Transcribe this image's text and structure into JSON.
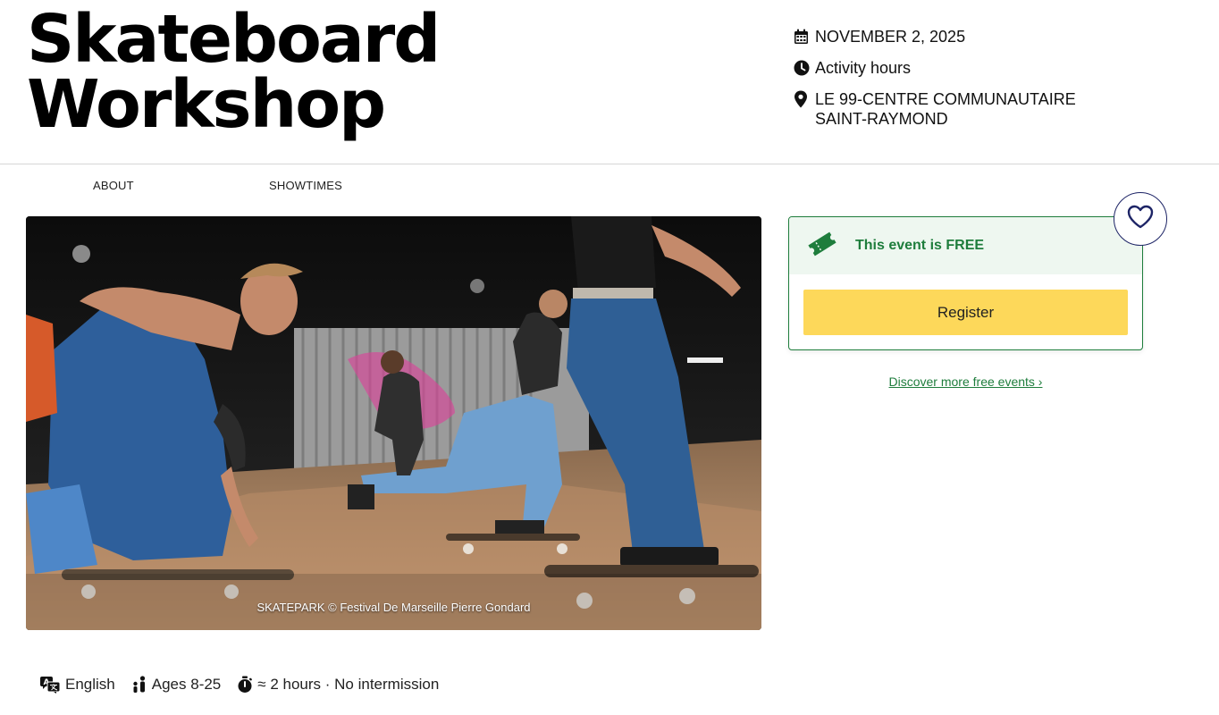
{
  "event": {
    "title_line1": "Skateboard",
    "title_line2": "Workshop"
  },
  "meta": {
    "date": "NOVEMBER 2, 2025",
    "hours": "Activity hours",
    "location": "LE 99-CENTRE COMMUNAUTAIRE SAINT-RAYMOND",
    "date_icon": "calendar-icon",
    "hours_icon": "clock-icon",
    "location_icon": "map-pin-icon"
  },
  "tabs": [
    {
      "label": "ABOUT"
    },
    {
      "label": "SHOWTIMES"
    }
  ],
  "photo": {
    "credit": "SKATEPARK © Festival De Marseille Pierre Gondard"
  },
  "ticket": {
    "label": "This event is FREE",
    "register_label": "Register",
    "icon": "ticket-icon",
    "accent_color": "#1e7d3c",
    "button_color": "#fdd85a"
  },
  "favorite": {
    "icon": "heart-icon"
  },
  "discover_link": "Discover more free events ›",
  "details": {
    "language": "English",
    "ages": "Ages 8-25",
    "duration": "≈ 2 hours · No intermission",
    "language_icon": "translate-icon",
    "ages_icon": "people-icon",
    "duration_icon": "stopwatch-icon"
  }
}
